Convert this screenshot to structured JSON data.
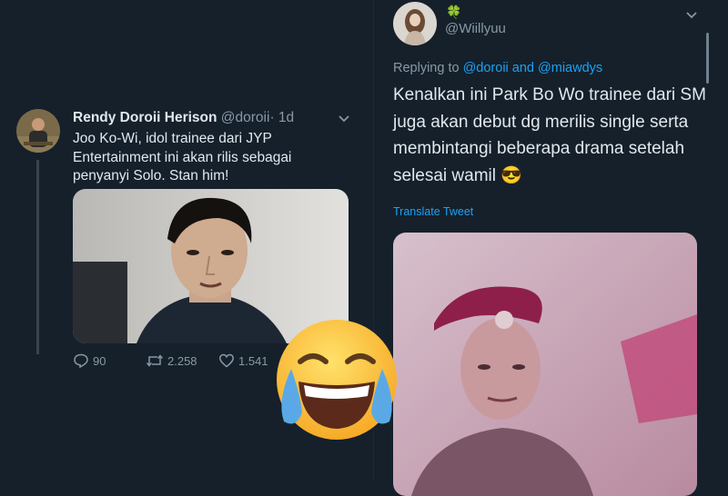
{
  "left_tweet": {
    "display_name": "Rendy Doroii Herison",
    "handle": "@doroii",
    "separator": "·",
    "time": "1d",
    "text_lines": [
      "Joo Ko-Wi, idol trainee dari JYP",
      "Entertainment ini akan rilis sebagai",
      "penyanyi Solo. Stan him!"
    ],
    "actions": {
      "replies": "90",
      "retweets": "2.258",
      "likes": "1.541"
    }
  },
  "right_tweet": {
    "name_icon": "four-leaf-clover-icon",
    "name_glyph": "🍀",
    "handle": "@Wiillyuu",
    "replying_prefix": "Replying to",
    "reply_to_1": "@doroii",
    "reply_and": "and",
    "reply_to_2": "@miawdys",
    "text_lines": [
      "Kenalkan ini Park Bo Wo trainee dari SM",
      "juga akan debut dg merilis single serta",
      "membintangi beberapa drama setelah",
      "selesai wamil"
    ],
    "text_emoji": "😎",
    "translate_label": "Translate Tweet"
  },
  "overlay": {
    "emoji_icon": "laughing-crying-emoji-icon",
    "emoji_glyph": "😂"
  },
  "colors": {
    "background": "#15202b",
    "text": "#e1e8ed",
    "muted": "#8899a6",
    "accent": "#1da1f2"
  }
}
